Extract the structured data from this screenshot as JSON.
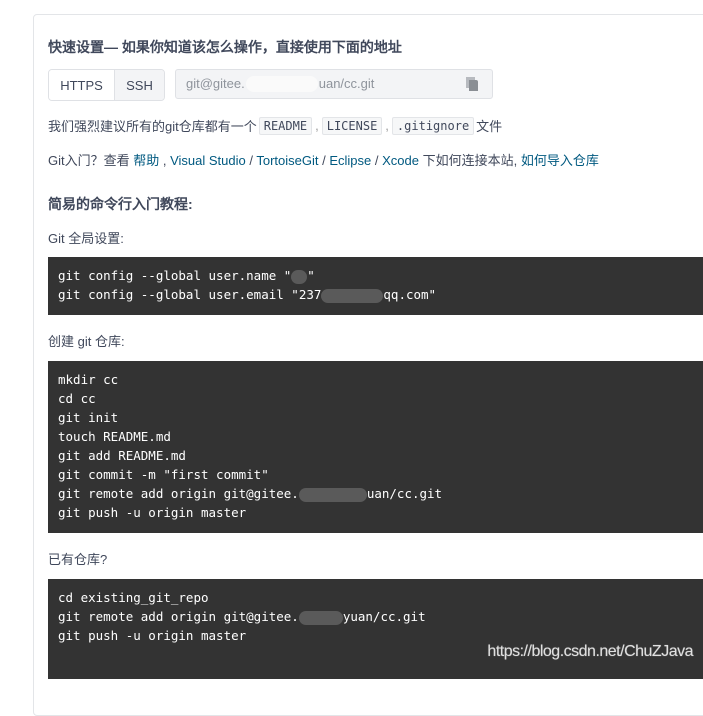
{
  "quick_setup": {
    "title": "快速设置— 如果你知道该怎么操作，直接使用下面的地址",
    "protocols": [
      {
        "label": "HTTPS",
        "active": false
      },
      {
        "label": "SSH",
        "active": true
      }
    ],
    "url_prefix": "git@gitee.",
    "url_suffix": "uan/cc.git",
    "copy_icon": "copy-icon"
  },
  "recommend": {
    "prefix": "我们强烈建议所有的git仓库都有一个",
    "files": [
      "README",
      "LICENSE",
      ".gitignore"
    ],
    "separator": ",",
    "suffix": "文件"
  },
  "help": {
    "prefix": "Git入门？查看 ",
    "links": [
      {
        "label": "帮助"
      },
      {
        "label": "Visual Studio"
      },
      {
        "label": "TortoiseGit"
      },
      {
        "label": "Eclipse"
      },
      {
        "label": "Xcode"
      }
    ],
    "middle": " 下如何连接本站, ",
    "import_link": "如何导入仓库"
  },
  "tutorial": {
    "heading": "简易的命令行入门教程:",
    "global_label": "Git 全局设置:",
    "global_lines": [
      {
        "pre": "git config --global user.name \"",
        "post": "\""
      },
      {
        "pre": "git config --global user.email \"237",
        "post": "qq.com\""
      }
    ],
    "create_label": "创建 git 仓库:",
    "create_lines": [
      "mkdir cc",
      "cd cc",
      "git init",
      "touch README.md",
      "git add README.md",
      "git commit -m \"first commit\""
    ],
    "create_remote": {
      "pre": "git remote add origin git@gitee.",
      "post": "uan/cc.git"
    },
    "create_push": "git push -u origin master",
    "existing_label": "已有仓库?",
    "existing_lines": [
      "cd existing_git_repo"
    ],
    "existing_remote": {
      "pre": "git remote add origin git@gitee.",
      "post": "yuan/cc.git"
    },
    "existing_push": "git push -u origin master"
  },
  "watermark": "https://blog.csdn.net/ChuZJava"
}
